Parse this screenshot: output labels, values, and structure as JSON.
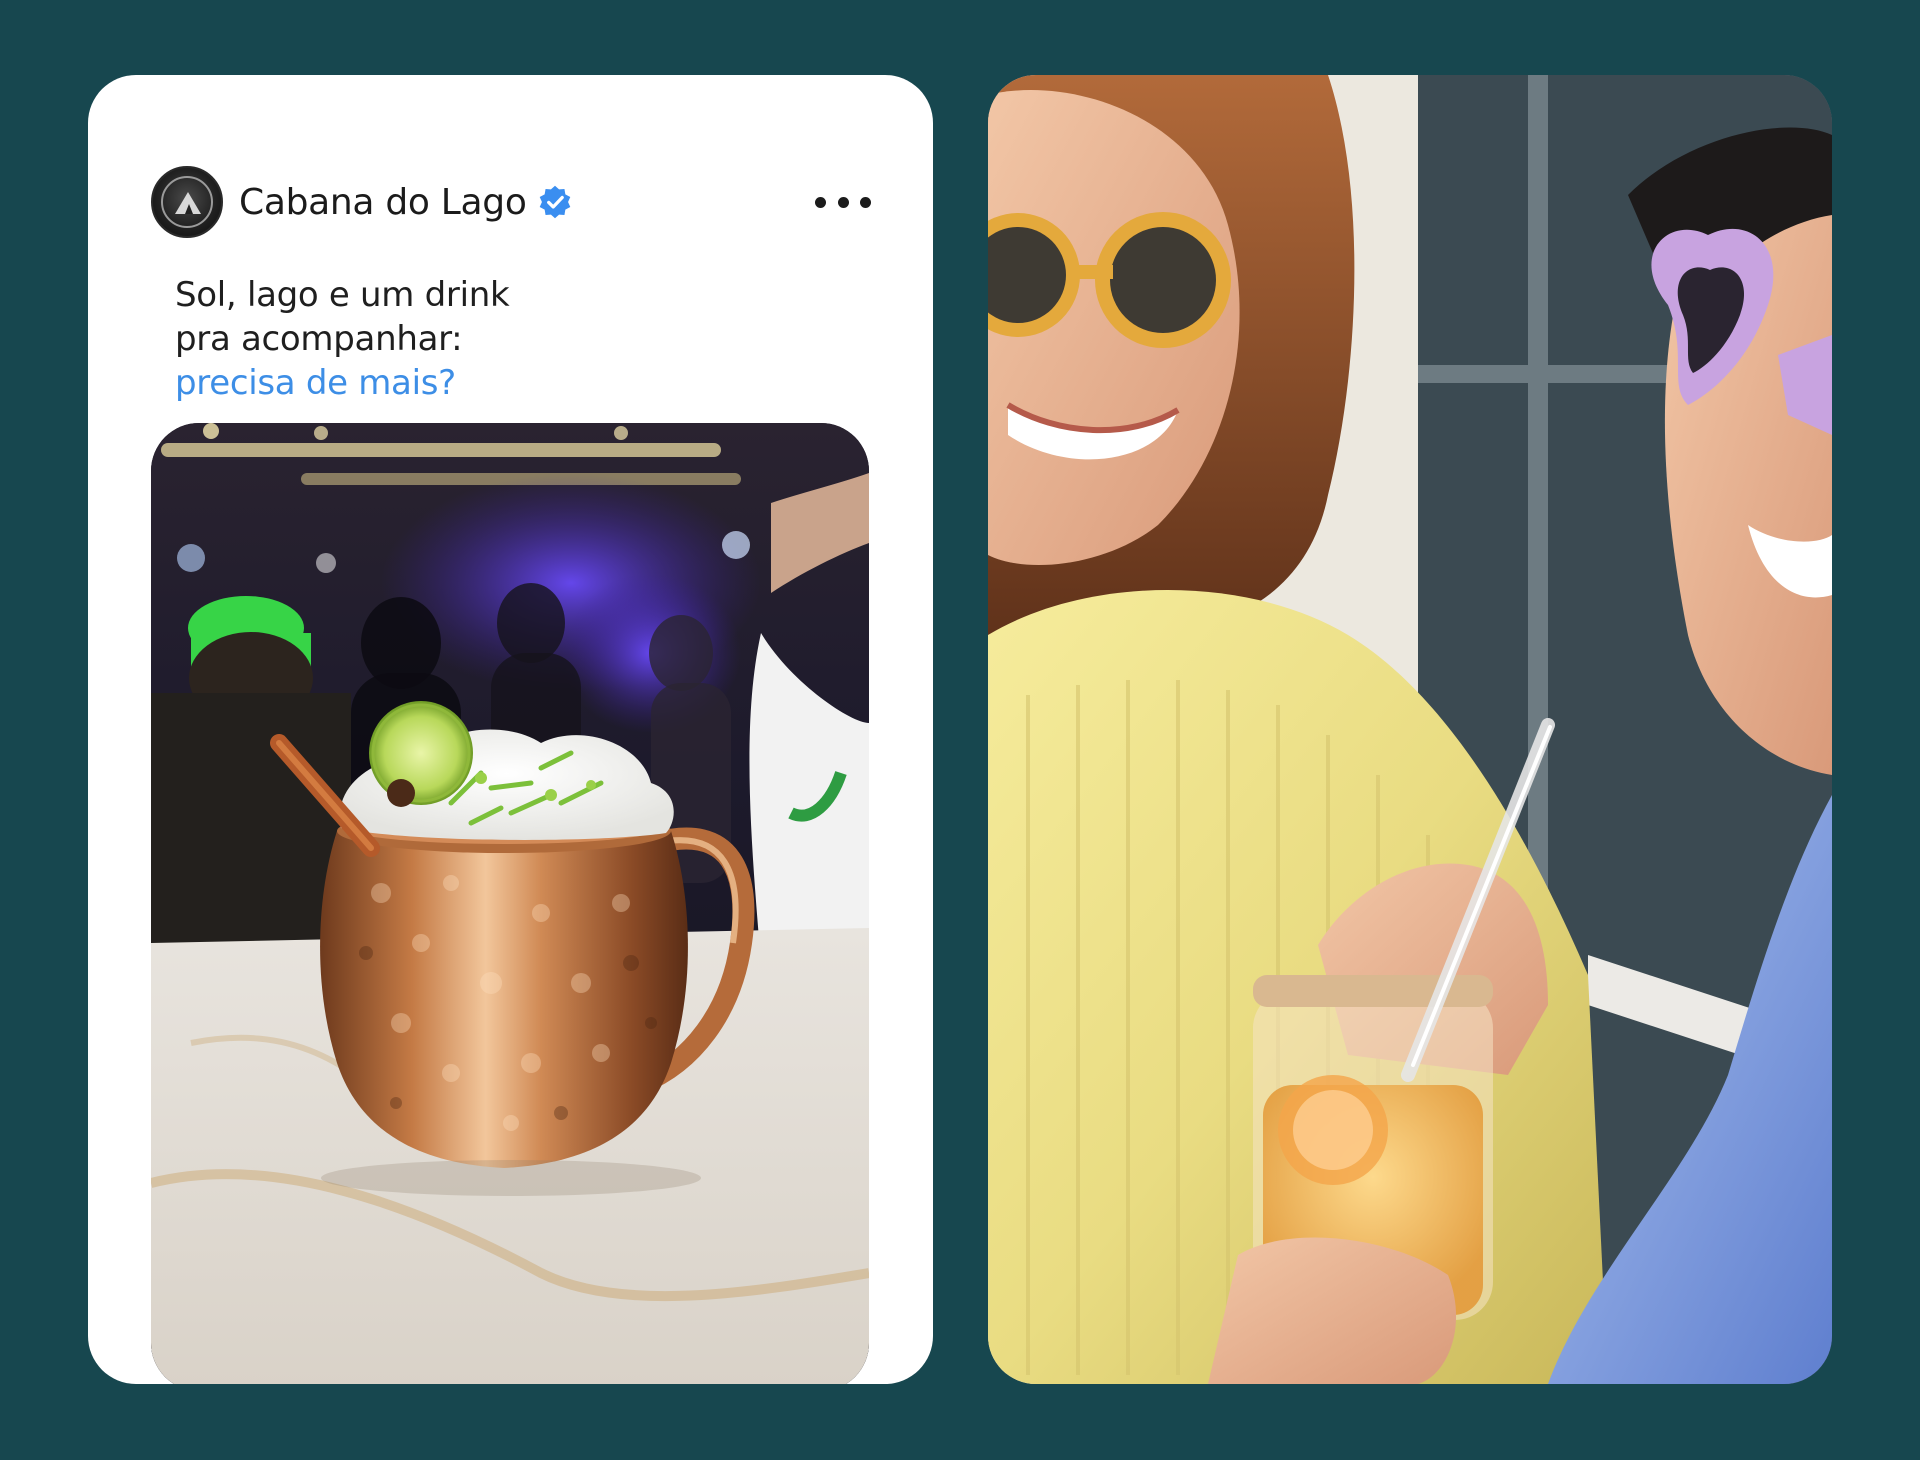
{
  "post": {
    "account_name": "Cabana do Lago",
    "avatar_icon": "cabana-do-lago-logo",
    "verified_icon": "verified-badge-icon",
    "more_icon": "more-horizontal-icon",
    "caption_lines": [
      "Sol, lago e um drink",
      "pra acompanhar:"
    ],
    "caption_highlight": "precisa de mais?",
    "photo_subject": "copper-mug-cocktail"
  },
  "side_photo": {
    "subject": "friends-drinking-sunglasses"
  },
  "colors": {
    "background": "#17474f",
    "card": "#ffffff",
    "text": "#1b1b1b",
    "accent_blue": "#3d8ee6",
    "verified_blue": "#3a8ef0"
  }
}
